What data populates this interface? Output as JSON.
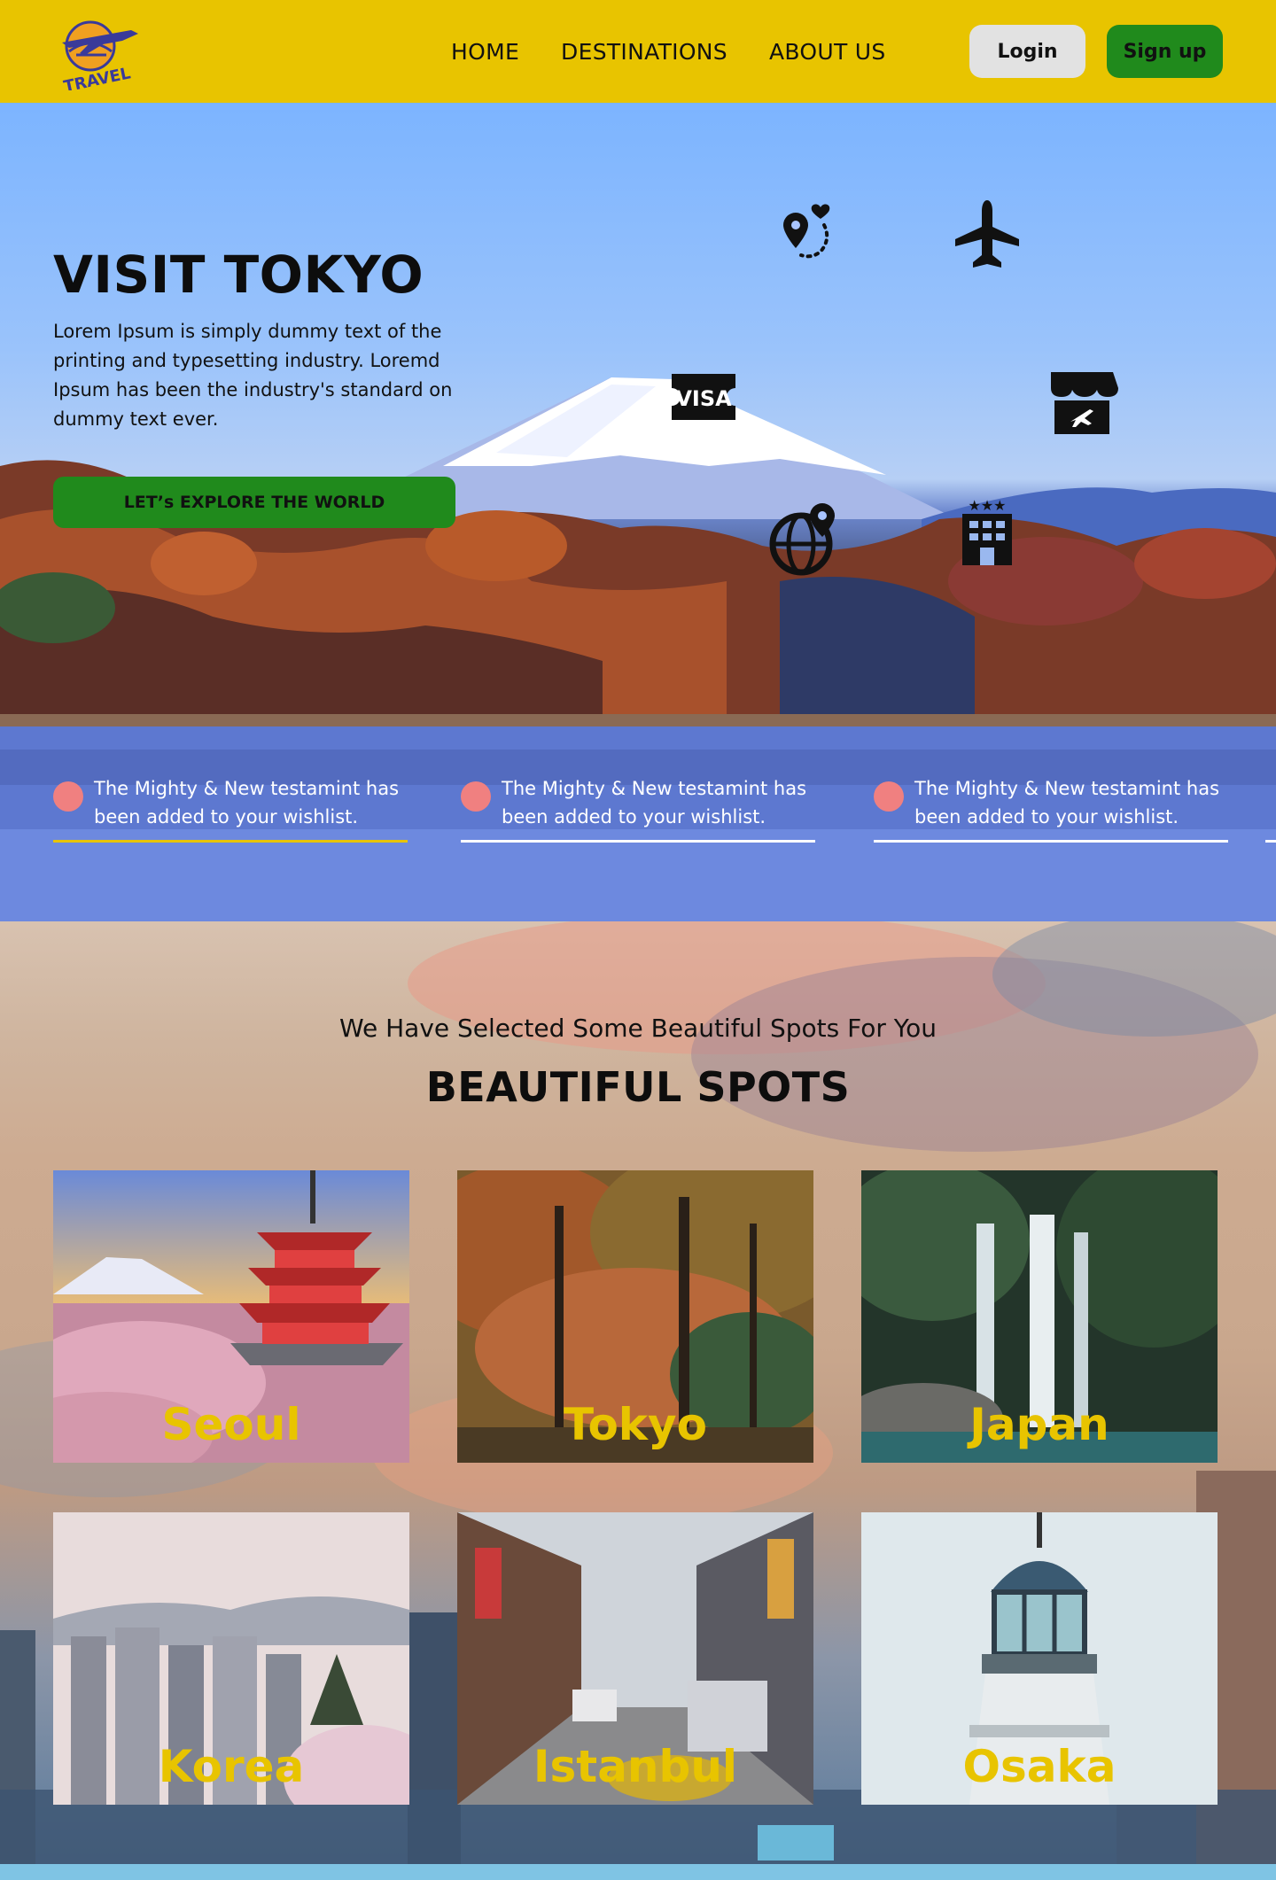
{
  "header": {
    "logo_text": "TRAVEL",
    "nav": [
      "HOME",
      "DESTINATIONS",
      "ABOUT US"
    ],
    "login_label": "Login",
    "signup_label": "Sign up"
  },
  "hero": {
    "title": "VISIT TOKYO",
    "description": "Lorem Ipsum is simply dummy text of the printing and typesetting industry. Loremd Ipsum has been the industry's standard on dummy text ever.",
    "cta_label": "LET’s EXPLORE THE WORLD",
    "visa_badge": "VISA",
    "icons": [
      "map-route-icon",
      "airplane-icon",
      "visa-icon",
      "travel-agency-icon",
      "globe-location-icon",
      "hotel-icon"
    ],
    "notifications": [
      {
        "text": "The Mighty & New testamint has been added to your wishlist."
      },
      {
        "text": "The Mighty & New testamint has been added to your wishlist."
      },
      {
        "text": "The Mighty & New testamint has been added to your wishlist."
      }
    ]
  },
  "spots": {
    "subtitle": "We Have Selected Some Beautiful Spots For You",
    "title": "BEAUTIFUL SPOTS",
    "cards": [
      {
        "label": "Seoul"
      },
      {
        "label": "Tokyo"
      },
      {
        "label": "Japan"
      },
      {
        "label": "Korea"
      },
      {
        "label": "Istanbul"
      },
      {
        "label": "Osaka"
      }
    ]
  },
  "colors": {
    "header_bg": "#e8c400",
    "accent_green": "#208a1c",
    "label_yellow": "#e8c400",
    "notice_dot": "#f08080"
  }
}
